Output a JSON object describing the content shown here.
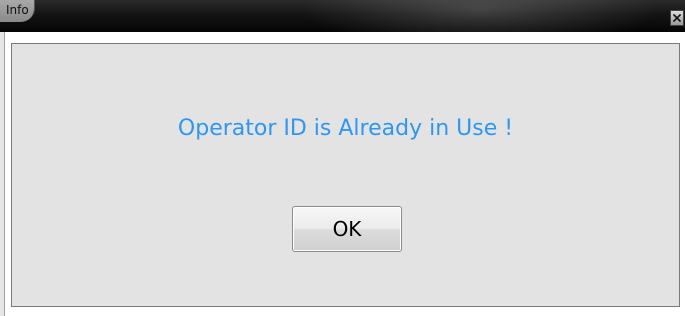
{
  "window": {
    "title": "Info",
    "close_icon": "close-icon"
  },
  "dialog": {
    "message": "Operator ID is Already in Use !",
    "ok_label": "OK"
  },
  "colors": {
    "message_text": "#2f97f0",
    "titlebar": "#141414",
    "panel_background": "#e3e3e3"
  }
}
